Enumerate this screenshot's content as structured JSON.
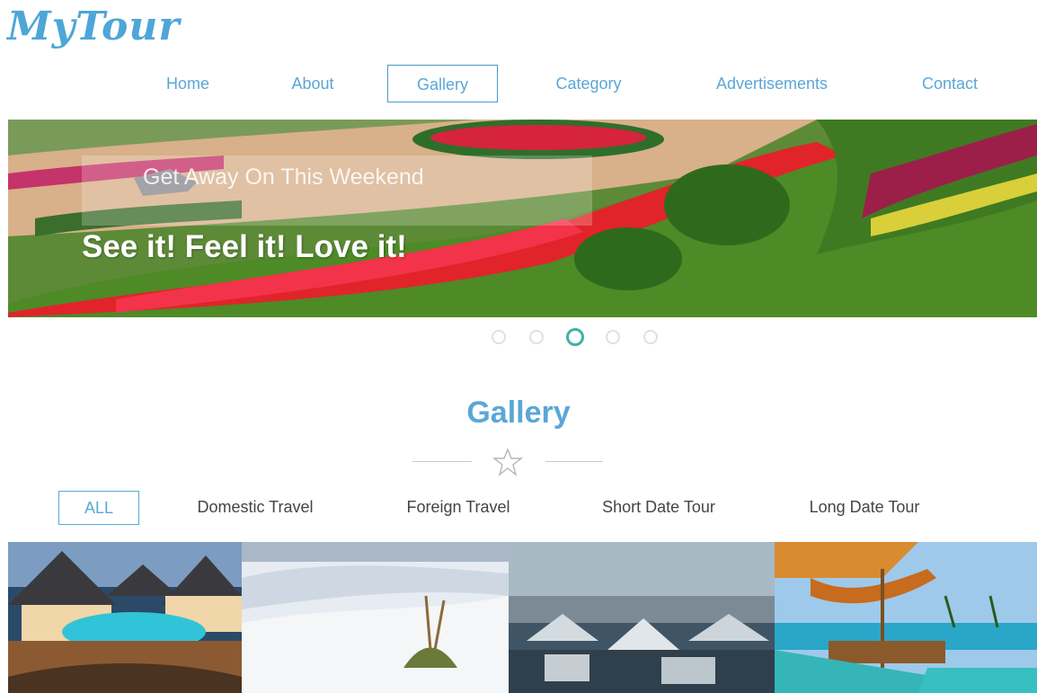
{
  "brand": {
    "logo": "MyTour"
  },
  "nav": {
    "items": [
      {
        "label": "Home"
      },
      {
        "label": "About"
      },
      {
        "label": "Gallery",
        "active": true
      },
      {
        "label": "Category"
      },
      {
        "label": "Advertisements"
      },
      {
        "label": "Contact"
      }
    ]
  },
  "hero": {
    "subtitle": "Get Away On This Weekend",
    "title": "See it! Feel it! Love it!",
    "slide_count": 5,
    "active_slide": 3
  },
  "gallery": {
    "title": "Gallery",
    "star_icon": "star-outline-icon",
    "filters": [
      {
        "label": "ALL",
        "active": true
      },
      {
        "label": "Domestic Travel"
      },
      {
        "label": "Foreign Travel"
      },
      {
        "label": "Short Date Tour"
      },
      {
        "label": "Long Date Tour"
      }
    ],
    "images": [
      "beach-resort-image",
      "white-desert-image",
      "city-rooftops-image",
      "poolside-lounge-image"
    ]
  },
  "colors": {
    "accent": "#5aa7d6",
    "dot_active": "#3fb3a3"
  }
}
